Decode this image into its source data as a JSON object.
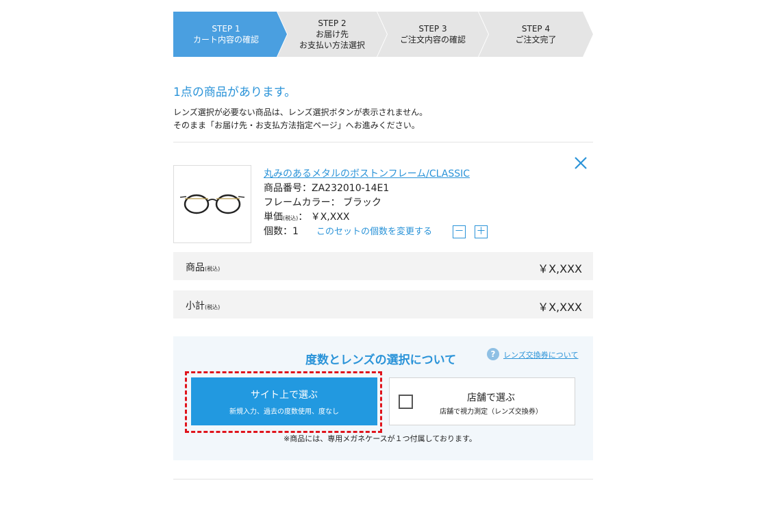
{
  "steps": [
    {
      "num": "STEP 1",
      "line1": "カート内容の確認",
      "line2": ""
    },
    {
      "num": "STEP 2",
      "line1": "お届け先",
      "line2": "お支払い方法選択"
    },
    {
      "num": "STEP 3",
      "line1": "ご注文内容の確認",
      "line2": ""
    },
    {
      "num": "STEP 4",
      "line1": "ご注文完了",
      "line2": ""
    }
  ],
  "cart": {
    "heading": "1点の商品があります。",
    "notice_line1": "レンズ選択が必要ない商品は、レンズ選択ボタンが表示されません。",
    "notice_line2": "そのまま「お届け先・お支払方法指定ページ」へお進みください。"
  },
  "product": {
    "name": "丸みのあるメタルのボストンフレーム/CLASSIC",
    "number_label": "商品番号：",
    "number": "ZA232010-14E1",
    "color_label": "フレームカラー：",
    "color": "ブラック",
    "price_label": "単価",
    "tax_note": "(税込)",
    "price_sep": "：",
    "price": "￥X,XXX",
    "qty_label": "個数：",
    "qty": "1",
    "qty_change_link": "このセットの個数を変更する",
    "minus": "－",
    "plus": "＋"
  },
  "summary": {
    "goods_label": "商品",
    "goods_tax": "(税込)",
    "goods_value": "￥X,XXX",
    "subtotal_label": "小計",
    "subtotal_tax": "(税込)",
    "subtotal_value": "￥X,XXX"
  },
  "lens": {
    "title": "度数とレンズの選択について",
    "help_icon": "?",
    "voucher_link": "レンズ交換券について",
    "site_main": "サイト上で選ぶ",
    "site_sub": "新規入力、過去の度数使用、度なし",
    "store_main": "店舗で選ぶ",
    "store_sub": "店舗で視力測定（レンズ交換券）",
    "case_note": "※商品には、専用メガネケースが１つ付属しております。"
  },
  "icons": {
    "close": "close-icon",
    "help": "question-icon",
    "product_image": "glasses-icon"
  },
  "colors": {
    "accent": "#2a93d8",
    "step_active": "#4a9fe0",
    "step_inactive": "#e5e5e5",
    "highlight_dash": "#e0141c",
    "primary_button": "#2299e0"
  }
}
